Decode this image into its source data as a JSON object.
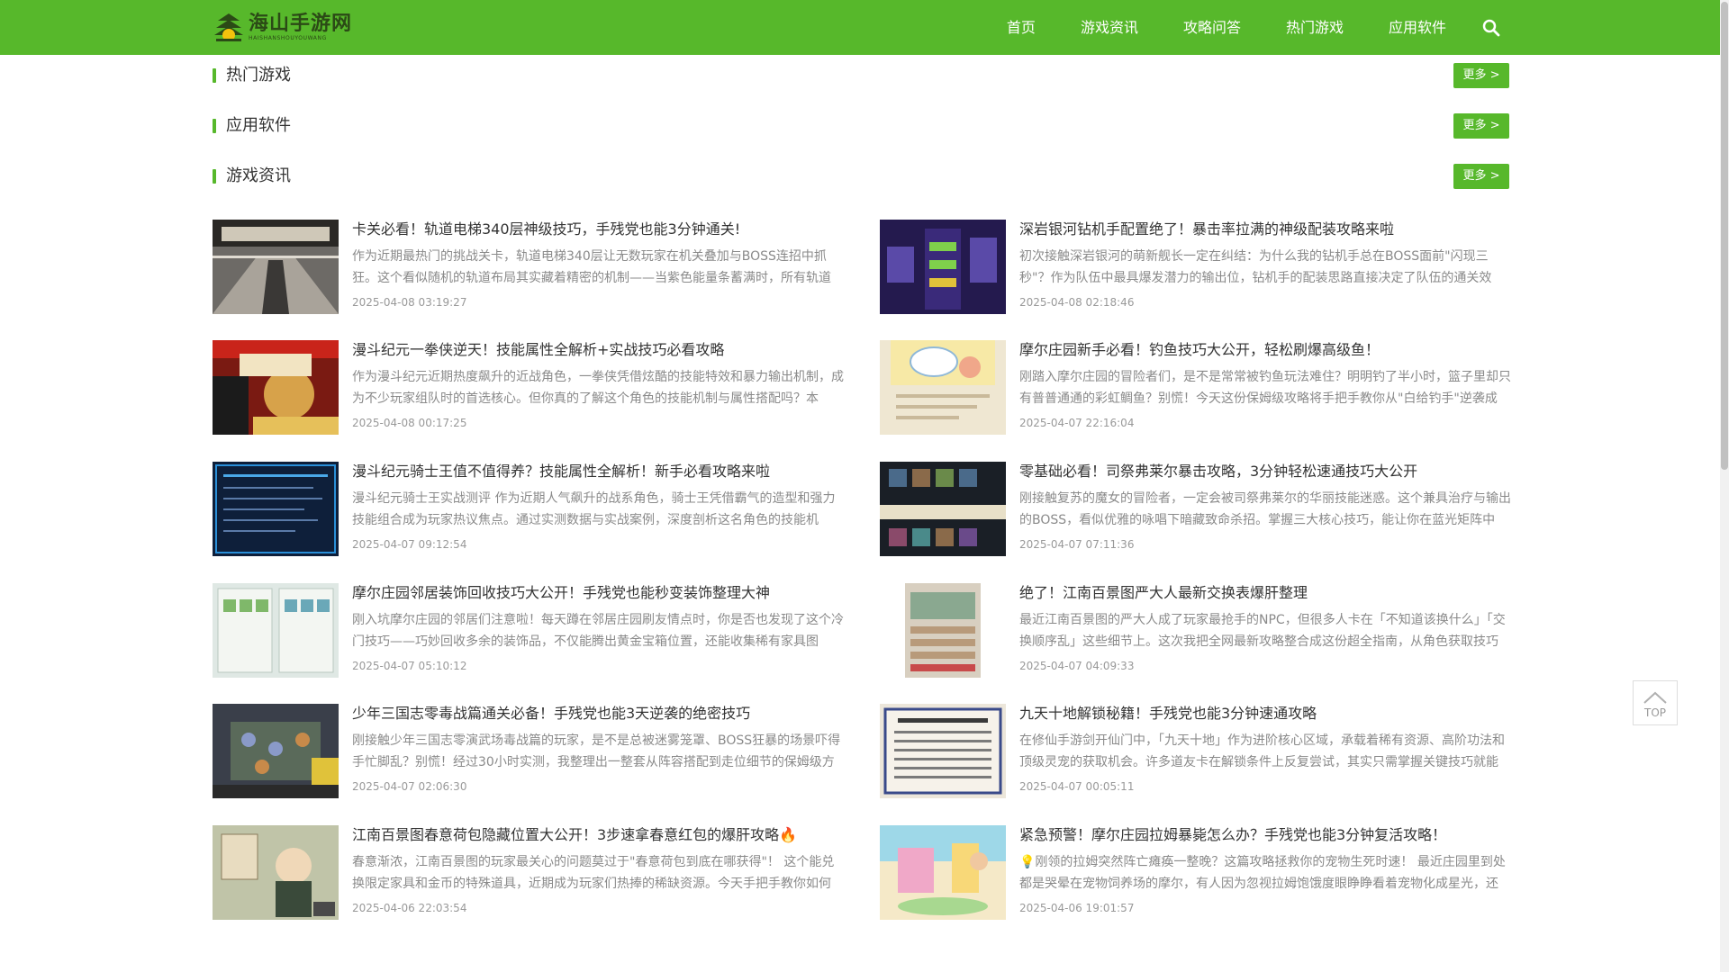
{
  "site": {
    "logo_title": "海山手游网",
    "logo_subtitle": "HAISHANSHOUYOUWANG"
  },
  "nav": {
    "items": [
      {
        "label": "首页"
      },
      {
        "label": "游戏资讯"
      },
      {
        "label": "攻略问答"
      },
      {
        "label": "热门游戏"
      },
      {
        "label": "应用软件"
      }
    ],
    "search_icon": "search-icon"
  },
  "sections": [
    {
      "title": "热门游戏",
      "more": "更多 >"
    },
    {
      "title": "应用软件",
      "more": "更多 >"
    },
    {
      "title": "游戏资讯",
      "more": "更多 >"
    }
  ],
  "articles": [
    {
      "title": "卡关必看！轨道电梯340层神级技巧，手残党也能3分钟通关!",
      "summary": "作为近期最热门的挑战关卡，轨道电梯340层让无数玩家在机关叠加与BOSS连招中抓狂。这个看似随机的轨道布局其实藏着精密的机制——当紫色能量条蓄满时，所有轨道",
      "date": "2025-04-08 03:19:27"
    },
    {
      "title": "深岩银河钻机手配置绝了！暴击率拉满的神级配装攻略来啦",
      "summary": "初次接触深岩银河的萌新舰长一定在纠结：为什么我的钻机手总在BOSS面前\"闪现三秒\"？作为队伍中最具爆发潜力的输出位，钻机手的配装思路直接决定了队伍的通关效",
      "date": "2025-04-08 02:18:46"
    },
    {
      "title": "漫斗纪元一拳侠逆天！技能属性全解析+实战技巧必看攻略",
      "summary": "作为漫斗纪元近期热度飙升的近战角色，一拳侠凭借炫酷的技能特效和暴力输出机制，成为不少玩家组队时的首选核心。但你真的了解这个角色的技能机制与属性搭配吗？本",
      "date": "2025-04-08 00:17:25"
    },
    {
      "title": "摩尔庄园新手必看！钓鱼技巧大公开，轻松刷爆高级鱼！",
      "summary": "刚踏入摩尔庄园的冒险者们，是不是常常被钓鱼玩法难住？明明钓了半小时，篮子里却只有普普通通的彩虹鲷鱼？别慌！今天这份保姆级攻略将手把手教你从\"白给钓手\"逆袭成",
      "date": "2025-04-07 22:16:04"
    },
    {
      "title": "漫斗纪元骑士王值不值得养？技能属性全解析！新手必看攻略来啦",
      "summary": "漫斗纪元骑士王实战测评 作为近期人气飙升的战系角色，骑士王凭借霸气的造型和强力技能组合成为玩家热议焦点。通过实测数据与实战案例，深度剖析这名角色的技能机",
      "date": "2025-04-07 09:12:54"
    },
    {
      "title": "零基础必看！司祭弗莱尔暴击攻略，3分钟轻松速通技巧大公开",
      "summary": "刚接触复苏的魔女的冒险者，一定会被司祭弗莱尔的华丽技能迷惑。这个兼具治疗与输出的BOSS，看似优雅的咏唱下暗藏致命杀招。掌握三大核心技巧，能让你在蓝光矩阵中",
      "date": "2025-04-07 07:11:36"
    },
    {
      "title": "摩尔庄园邻居装饰回收技巧大公开！手残党也能秒变装饰整理大神",
      "summary": "刚入坑摩尔庄园的邻居们注意啦！每天蹲在邻居庄园刷友情点时，你是否也发现了这个冷门技巧——巧妙回收多余的装饰品，不仅能腾出黄金宝箱位置，还能收集稀有家具图",
      "date": "2025-04-07 05:10:12"
    },
    {
      "title": "绝了！江南百景图严大人最新交换表爆肝整理",
      "summary": "最近江南百景图的严大人成了玩家最抢手的NPC，但很多人卡在「不知道该换什么」「交换顺序乱」这些细节上。这次我把全网最新攻略整合成这份超全指南，从角色获取技巧",
      "date": "2025-04-07 04:09:33"
    },
    {
      "title": "少年三国志零毒战篇通关必备！手残党也能3天逆袭的绝密技巧",
      "summary": "刚接触少年三国志零演武场毒战篇的玩家，是不是总被迷雾笼罩、BOSS狂暴的场景吓得手忙脚乱？别慌！经过30小时实测，我整理出一整套从阵容搭配到走位细节的保姆级方",
      "date": "2025-04-07 02:06:30"
    },
    {
      "title": "九天十地解锁秘籍！手残党也能3分钟速通攻略",
      "summary": "在修仙手游剑开仙门中，「九天十地」作为进阶核心区域，承载着稀有资源、高阶功法和顶级灵宠的获取机会。许多道友卡在解锁条件上反复尝试，其实只需掌握关键技巧就能",
      "date": "2025-04-07 00:05:11"
    },
    {
      "title": "江南百景图春意荷包隐藏位置大公开！3步速拿春意红包的爆肝攻略🔥",
      "summary": "春意渐浓，江南百景图的玩家最关心的问题莫过于\"春意荷包到底在哪获得\"！ 这个能兑换限定家具和金币的特殊道具，近期成为玩家们热捧的稀缺资源。今天手把手教你如何",
      "date": "2025-04-06 22:03:54"
    },
    {
      "title": "紧急预警！摩尔庄园拉姆暴毙怎么办？手残党也能3分钟复活攻略！",
      "summary": "💡刚领的拉姆突然阵亡瘫痪一整晚？这篇攻略拯救你的宠物生死时速！ 最近庄园里到处都是哭晕在宠物饲养场的摩尔，有人因为忽视拉姆饱饿度眼睁睁看着宠物化成星光，还",
      "date": "2025-04-06 19:01:57"
    }
  ],
  "back_to_top": {
    "label": "TOP"
  }
}
